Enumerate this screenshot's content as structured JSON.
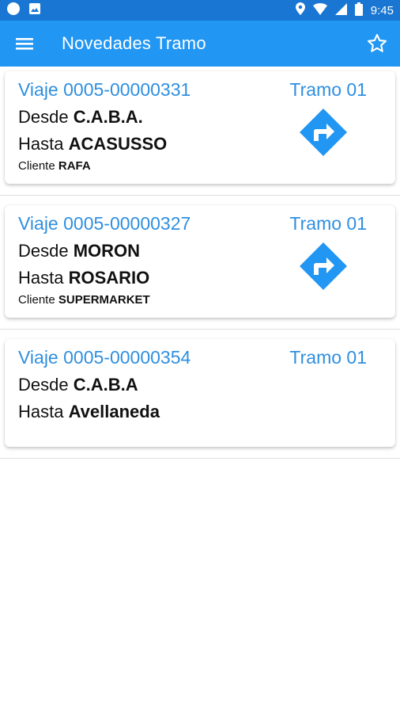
{
  "status_bar": {
    "time": "9:45"
  },
  "app_bar": {
    "title": "Novedades Tramo"
  },
  "trips": [
    {
      "viaje": "Viaje 0005-00000331",
      "tramo": "Tramo 01",
      "desde_label": "Desde",
      "desde": "C.A.B.A.",
      "hasta_label": "Hasta",
      "hasta": "ACASUSSO",
      "cliente_label": "Cliente",
      "cliente": "RAFA"
    },
    {
      "viaje": "Viaje 0005-00000327",
      "tramo": "Tramo 01",
      "desde_label": "Desde",
      "desde": "MORON",
      "hasta_label": "Hasta",
      "hasta": "ROSARIO",
      "cliente_label": "Cliente",
      "cliente": "SUPERMARKET"
    },
    {
      "viaje": "Viaje 0005-00000354",
      "tramo": "Tramo 01",
      "desde_label": "Desde",
      "desde": "C.A.B.A",
      "hasta_label": "Hasta",
      "hasta": "Avellaneda"
    }
  ],
  "colors": {
    "status_bar": "#1976d2",
    "app_bar": "#2196f3",
    "accent_text": "#2f8fe0",
    "nav_icon": "#2196f3"
  }
}
